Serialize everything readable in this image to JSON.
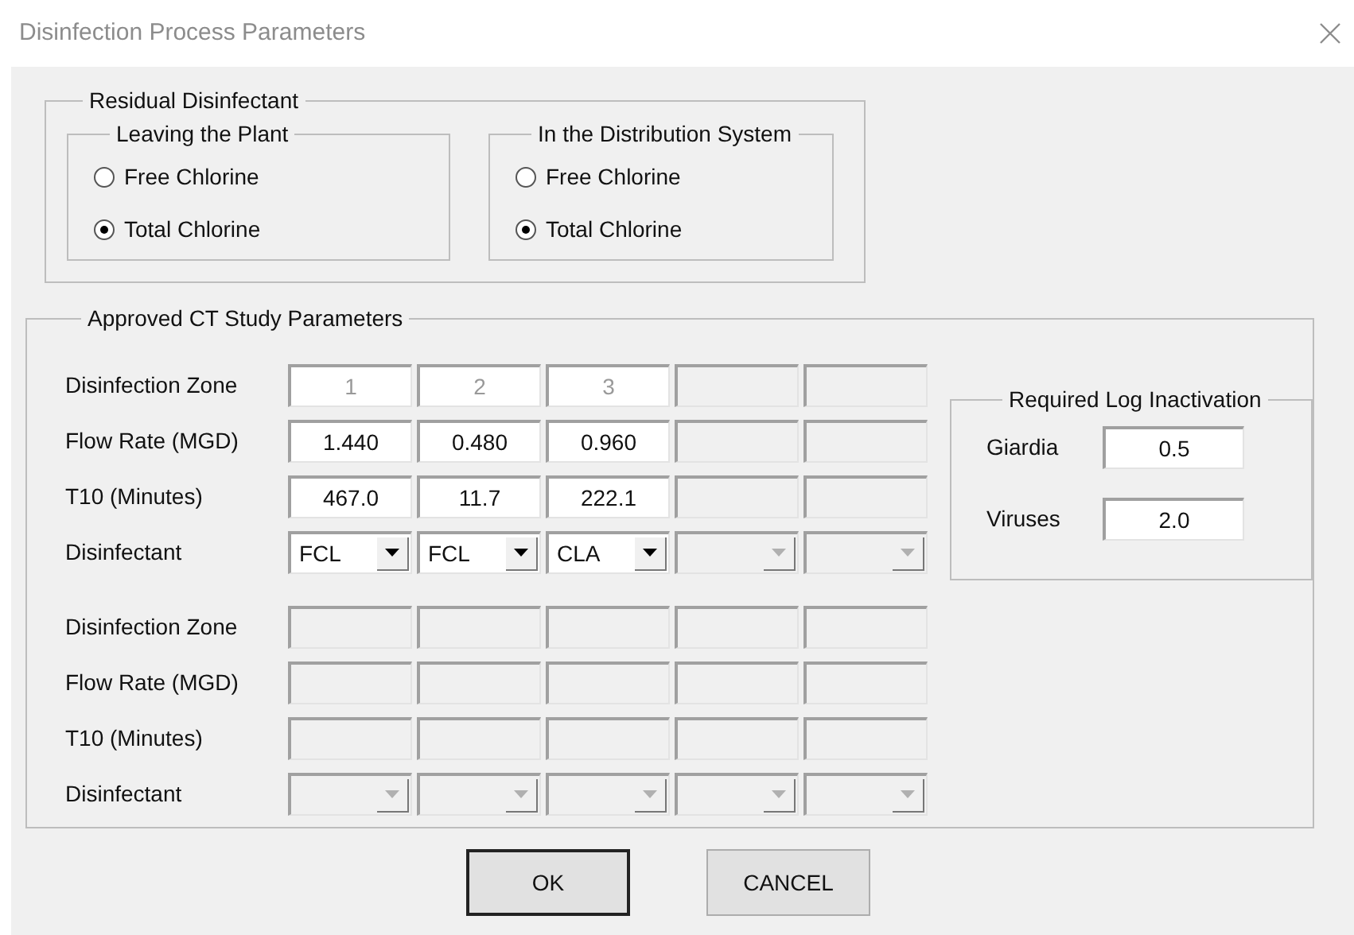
{
  "window": {
    "title": "Disinfection Process Parameters"
  },
  "residual": {
    "title": "Residual Disinfectant",
    "groups": [
      {
        "title": "Leaving the Plant",
        "options": [
          {
            "label": "Free Chlorine",
            "selected": false
          },
          {
            "label": "Total Chlorine",
            "selected": true
          }
        ]
      },
      {
        "title": "In the Distribution System",
        "options": [
          {
            "label": "Free Chlorine",
            "selected": false
          },
          {
            "label": "Total Chlorine",
            "selected": true
          }
        ]
      }
    ]
  },
  "ct_study": {
    "title": "Approved CT Study Parameters",
    "blocks": [
      {
        "rows": [
          {
            "label": "Disinfection Zone",
            "kind": "zone",
            "cells": [
              {
                "value": "1",
                "disabled": false
              },
              {
                "value": "2",
                "disabled": false
              },
              {
                "value": "3",
                "disabled": false
              },
              {
                "disabled": true
              },
              {
                "disabled": true
              }
            ]
          },
          {
            "label": "Flow Rate (MGD)",
            "kind": "text",
            "cells": [
              {
                "value": "1.440",
                "disabled": false
              },
              {
                "value": "0.480",
                "disabled": false
              },
              {
                "value": "0.960",
                "disabled": false
              },
              {
                "disabled": true
              },
              {
                "disabled": true
              }
            ]
          },
          {
            "label": "T10 (Minutes)",
            "kind": "text",
            "cells": [
              {
                "value": "467.0",
                "disabled": false
              },
              {
                "value": "11.7",
                "disabled": false
              },
              {
                "value": "222.1",
                "disabled": false
              },
              {
                "disabled": true
              },
              {
                "disabled": true
              }
            ]
          },
          {
            "label": "Disinfectant",
            "kind": "select",
            "cells": [
              {
                "value": "FCL",
                "disabled": false
              },
              {
                "value": "FCL",
                "disabled": false
              },
              {
                "value": "CLA",
                "disabled": false
              },
              {
                "disabled": true
              },
              {
                "disabled": true
              }
            ]
          }
        ]
      },
      {
        "rows": [
          {
            "label": "Disinfection Zone",
            "kind": "zone",
            "cells": [
              {
                "disabled": true
              },
              {
                "disabled": true
              },
              {
                "disabled": true
              },
              {
                "disabled": true
              },
              {
                "disabled": true
              }
            ]
          },
          {
            "label": "Flow Rate (MGD)",
            "kind": "text",
            "cells": [
              {
                "disabled": true
              },
              {
                "disabled": true
              },
              {
                "disabled": true
              },
              {
                "disabled": true
              },
              {
                "disabled": true
              }
            ]
          },
          {
            "label": "T10 (Minutes)",
            "kind": "text",
            "cells": [
              {
                "disabled": true
              },
              {
                "disabled": true
              },
              {
                "disabled": true
              },
              {
                "disabled": true
              },
              {
                "disabled": true
              }
            ]
          },
          {
            "label": "Disinfectant",
            "kind": "select",
            "cells": [
              {
                "disabled": true
              },
              {
                "disabled": true
              },
              {
                "disabled": true
              },
              {
                "disabled": true
              },
              {
                "disabled": true
              }
            ]
          }
        ]
      }
    ],
    "log_inactivation": {
      "title": "Required Log Inactivation",
      "fields": [
        {
          "label": "Giardia",
          "value": "0.5"
        },
        {
          "label": "Viruses",
          "value": "2.0"
        }
      ]
    }
  },
  "buttons": [
    {
      "label": "OK",
      "default": true
    },
    {
      "label": "CANCEL",
      "default": false
    }
  ]
}
